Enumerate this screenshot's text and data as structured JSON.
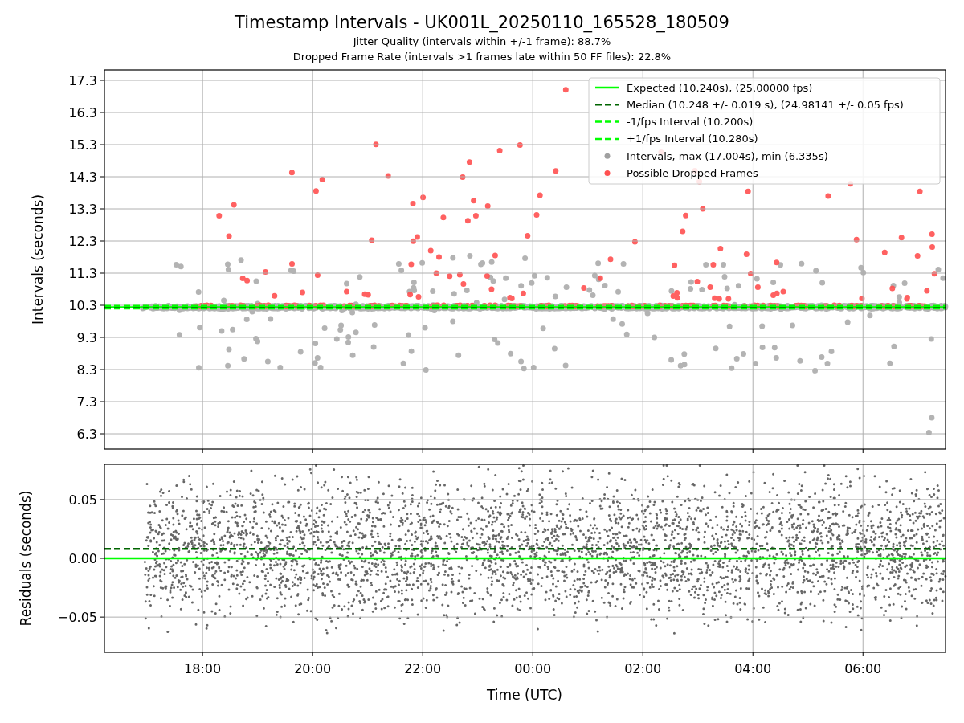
{
  "figure": {
    "title": "Timestamp Intervals - UK001L_20250110_165528_180509",
    "subtitles": [
      "Jitter Quality (intervals within +/-1 frame): 88.7%",
      "Dropped Frame Rate (intervals >1 frames late within 50 FF files): 22.8%"
    ]
  },
  "top": {
    "chart_data": {
      "type": "line",
      "ylabel": "Intervals (seconds)",
      "grid": true,
      "legend": true,
      "x": [
        "2025-01-10T16:13:00Z",
        "2025-01-11T07:30:00Z"
      ],
      "xlim": [
        "2025-01-10T16:13:00Z",
        "2025-01-11T07:30:00Z"
      ],
      "ylim": [
        5.825,
        17.625
      ],
      "yticks": [
        {
          "value": 6.3,
          "label": "6.3"
        },
        {
          "value": 7.3,
          "label": "7.3"
        },
        {
          "value": 8.3,
          "label": "8.3"
        },
        {
          "value": 9.3,
          "label": "9.3"
        },
        {
          "value": 10.3,
          "label": "10.3"
        },
        {
          "value": 11.3,
          "label": "11.3"
        },
        {
          "value": 12.3,
          "label": "12.3"
        },
        {
          "value": 13.3,
          "label": "13.3"
        },
        {
          "value": 14.3,
          "label": "14.3"
        },
        {
          "value": 15.3,
          "label": "15.3"
        },
        {
          "value": 16.3,
          "label": "16.3"
        },
        {
          "value": 17.3,
          "label": "17.3"
        }
      ],
      "series": [
        {
          "name": "Expected (10.240s), (25.00000 fps)",
          "color": "#00ff00",
          "line_style": "solid",
          "values": [
            10.24,
            10.24
          ]
        },
        {
          "name": "Median (10.248 +/- 0.019 s), (24.98141 +/- 0.05 fps)",
          "color": "#006400",
          "line_style": "dashed",
          "values": [
            10.248,
            10.248
          ]
        },
        {
          "name": "-1/fps Interval (10.200s)",
          "color": "#00ff00",
          "line_style": "dashed",
          "values": [
            10.2,
            10.2
          ]
        },
        {
          "name": "+1/fps Interval (10.280s)",
          "color": "#00ff00",
          "line_style": "dashed",
          "values": [
            10.28,
            10.28
          ]
        }
      ]
    },
    "scatter_legend": [
      {
        "label": "Intervals, max (17.004s), min (6.335s)",
        "color": "#a0a0a0"
      },
      {
        "label": "Possible Dropped Frames",
        "color": "#ff5050"
      }
    ]
  },
  "bottom": {
    "chart_data": {
      "type": "line",
      "xlabel": "Time (UTC)",
      "ylabel": "Residuals (seconds)",
      "grid": true,
      "x": [
        "2025-01-10T16:13:00Z",
        "2025-01-11T07:30:00Z"
      ],
      "xlim": [
        "2025-01-10T16:13:00Z",
        "2025-01-11T07:30:00Z"
      ],
      "ylim": [
        -0.08,
        0.08
      ],
      "xticks": [
        {
          "value": "2025-01-10T18:00:00Z",
          "label": "18:00"
        },
        {
          "value": "2025-01-10T20:00:00Z",
          "label": "20:00"
        },
        {
          "value": "2025-01-10T22:00:00Z",
          "label": "22:00"
        },
        {
          "value": "2025-01-11T00:00:00Z",
          "label": "00:00"
        },
        {
          "value": "2025-01-11T02:00:00Z",
          "label": "02:00"
        },
        {
          "value": "2025-01-11T04:00:00Z",
          "label": "04:00"
        },
        {
          "value": "2025-01-11T06:00:00Z",
          "label": "06:00"
        }
      ],
      "yticks": [
        {
          "value": -0.05,
          "label": "−0.05"
        },
        {
          "value": 0,
          "label": "0.00"
        },
        {
          "value": 0.05,
          "label": "0.05"
        }
      ],
      "series": [
        {
          "color": "#00ff00",
          "line_style": "solid",
          "values": [
            0,
            0
          ]
        },
        {
          "color": "#006400",
          "line_style": "dashed",
          "values": [
            0.008,
            0.008
          ]
        }
      ]
    }
  }
}
